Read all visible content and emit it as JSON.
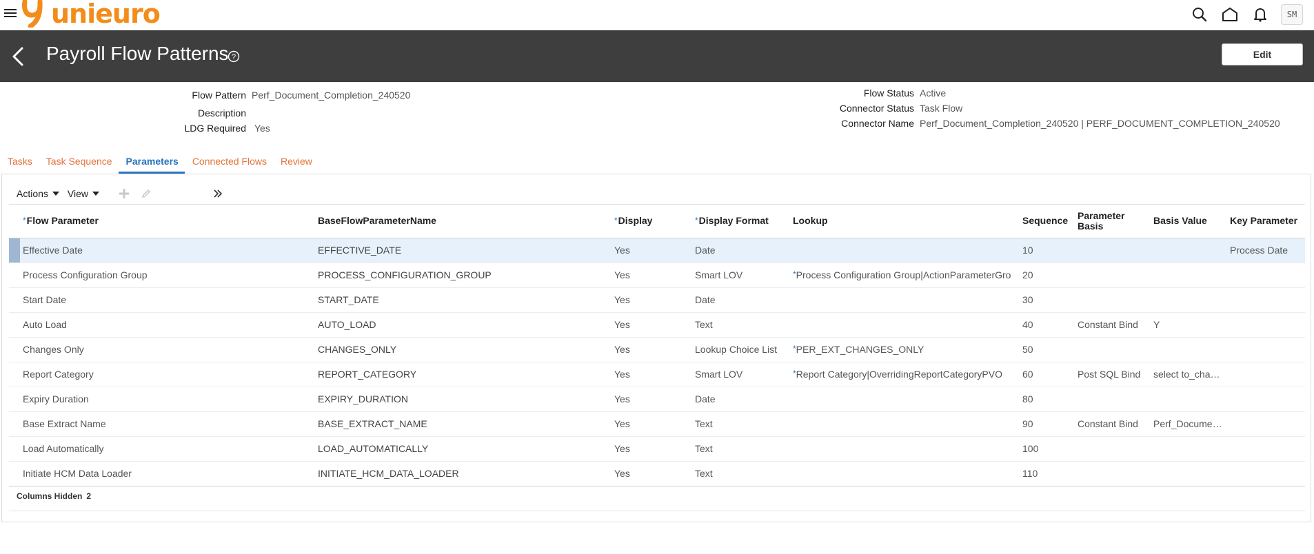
{
  "app": {
    "brand": "unieuro",
    "brand_color": "#f28c1a",
    "user_initials": "SM"
  },
  "header": {
    "title": "Payroll Flow Patterns",
    "edit_label": "Edit",
    "background": "#3e3e3e"
  },
  "details": {
    "flow_pattern_label": "Flow Pattern",
    "flow_pattern_value": "Perf_Document_Completion_240520",
    "description_label": "Description",
    "description_value": "",
    "ldg_label": "LDG Required",
    "ldg_value": "Yes",
    "flow_status_label": "Flow Status",
    "flow_status_value": "Active",
    "connector_status_label": "Connector Status",
    "connector_status_value": "Task Flow",
    "connector_name_label": "Connector Name",
    "connector_name_value": "Perf_Document_Completion_240520 | PERF_DOCUMENT_COMPLETION_240520"
  },
  "tabs": [
    {
      "label": "Tasks",
      "active": false
    },
    {
      "label": "Task Sequence",
      "active": false
    },
    {
      "label": "Parameters",
      "active": true
    },
    {
      "label": "Connected Flows",
      "active": false
    },
    {
      "label": "Review",
      "active": false
    }
  ],
  "toolbar": {
    "actions_label": "Actions",
    "view_label": "View"
  },
  "table": {
    "columns": [
      {
        "label": "Flow Parameter",
        "required": true
      },
      {
        "label": "BaseFlowParameterName",
        "required": false
      },
      {
        "label": "Display",
        "required": true
      },
      {
        "label": "Display Format",
        "required": true
      },
      {
        "label": "Lookup",
        "required": false
      },
      {
        "label": "Sequence",
        "required": false
      },
      {
        "label": "Parameter Basis",
        "required": false
      },
      {
        "label": "Basis Value",
        "required": false
      },
      {
        "label": "Key Parameter",
        "required": false
      }
    ],
    "rows": [
      {
        "flow_parameter": "Effective Date",
        "base_name": "EFFECTIVE_DATE",
        "display": "Yes",
        "display_format": "Date",
        "lookup": "",
        "lookup_required": false,
        "sequence": "10",
        "parameter_basis": "",
        "basis_value": "",
        "key_parameter": "Process Date",
        "selected": true
      },
      {
        "flow_parameter": "Process Configuration Group",
        "base_name": "PROCESS_CONFIGURATION_GROUP",
        "display": "Yes",
        "display_format": "Smart LOV",
        "lookup": "Process Configuration Group|ActionParameterGro",
        "lookup_required": true,
        "sequence": "20",
        "parameter_basis": "",
        "basis_value": "",
        "key_parameter": ""
      },
      {
        "flow_parameter": "Start Date",
        "base_name": "START_DATE",
        "display": "Yes",
        "display_format": "Date",
        "lookup": "",
        "lookup_required": false,
        "sequence": "30",
        "parameter_basis": "",
        "basis_value": "",
        "key_parameter": ""
      },
      {
        "flow_parameter": "Auto Load",
        "base_name": "AUTO_LOAD",
        "display": "Yes",
        "display_format": "Text",
        "lookup": "",
        "lookup_required": false,
        "sequence": "40",
        "parameter_basis": "Constant Bind",
        "basis_value": "Y",
        "key_parameter": ""
      },
      {
        "flow_parameter": "Changes Only",
        "base_name": "CHANGES_ONLY",
        "display": "Yes",
        "display_format": "Lookup Choice List",
        "lookup": "PER_EXT_CHANGES_ONLY",
        "lookup_required": true,
        "sequence": "50",
        "parameter_basis": "",
        "basis_value": "",
        "key_parameter": ""
      },
      {
        "flow_parameter": "Report Category",
        "base_name": "REPORT_CATEGORY",
        "display": "Yes",
        "display_format": "Smart LOV",
        "lookup": "Report Category|OverridingReportCategoryPVO",
        "lookup_required": true,
        "sequence": "60",
        "parameter_basis": "Post SQL Bind",
        "basis_value": "select to_cha…",
        "key_parameter": ""
      },
      {
        "flow_parameter": "Expiry Duration",
        "base_name": "EXPIRY_DURATION",
        "display": "Yes",
        "display_format": "Date",
        "lookup": "",
        "lookup_required": false,
        "sequence": "80",
        "parameter_basis": "",
        "basis_value": "",
        "key_parameter": ""
      },
      {
        "flow_parameter": "Base Extract Name",
        "base_name": "BASE_EXTRACT_NAME",
        "display": "Yes",
        "display_format": "Text",
        "lookup": "",
        "lookup_required": false,
        "sequence": "90",
        "parameter_basis": "Constant Bind",
        "basis_value": "Perf_Docume…",
        "key_parameter": ""
      },
      {
        "flow_parameter": "Load Automatically",
        "base_name": "LOAD_AUTOMATICALLY",
        "display": "Yes",
        "display_format": "Text",
        "lookup": "",
        "lookup_required": false,
        "sequence": "100",
        "parameter_basis": "",
        "basis_value": "",
        "key_parameter": ""
      },
      {
        "flow_parameter": "Initiate HCM Data Loader",
        "base_name": "INITIATE_HCM_DATA_LOADER",
        "display": "Yes",
        "display_format": "Text",
        "lookup": "",
        "lookup_required": false,
        "sequence": "110",
        "parameter_basis": "",
        "basis_value": "",
        "key_parameter": ""
      }
    ]
  },
  "footer": {
    "columns_hidden_label": "Columns Hidden",
    "columns_hidden_count": "2"
  }
}
